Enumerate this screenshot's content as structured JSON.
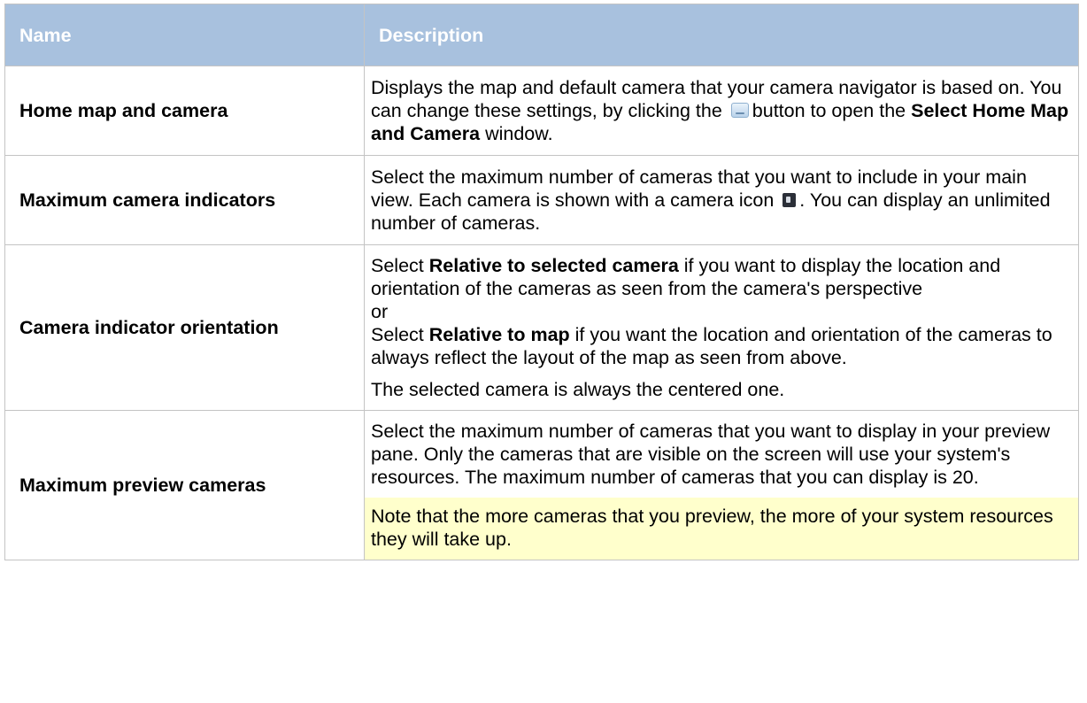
{
  "header": {
    "name": "Name",
    "description": "Description"
  },
  "rows": [
    {
      "name": "Home map and camera",
      "desc_a": "Displays the map and default camera that your camera navigator is based on. You can change these settings, by clicking the",
      "desc_b": "button to open the",
      "desc_bold": "Select Home Map and Camera",
      "desc_c": "window.",
      "icon": "browse-button-icon"
    },
    {
      "name": "Maximum camera indicators",
      "desc_a": "Select the maximum number of cameras that you want to include in your main view. Each camera is shown with a camera icon",
      "desc_b": ". You can display an unlimited number of cameras.",
      "icon": "camera-icon"
    },
    {
      "name": "Camera indicator orientation",
      "p1_a": "Select",
      "p1_bold": "Relative to selected camera",
      "p1_b": "if you want to display the location and orientation of the cameras as seen from the camera's perspective",
      "or": "or",
      "p2_a": "Select",
      "p2_bold": "Relative to map",
      "p2_b": "if you want the location and orientation of the cameras to always reflect the layout of the map as seen from above.",
      "p3": "The selected camera is always the centered one."
    },
    {
      "name": "Maximum preview cameras",
      "p1": "Select the maximum number of cameras that you want to display in your preview pane. Only the cameras that are visible on the screen will use your system's resources. The maximum number of cameras that you can display is 20.",
      "note": "Note that the more cameras that you preview, the more of your system resources they will take up."
    }
  ],
  "colors": {
    "header_bg": "#a8c1de",
    "header_text": "#ffffff",
    "note_bg": "#ffffcc",
    "border": "#c4c4c4"
  }
}
